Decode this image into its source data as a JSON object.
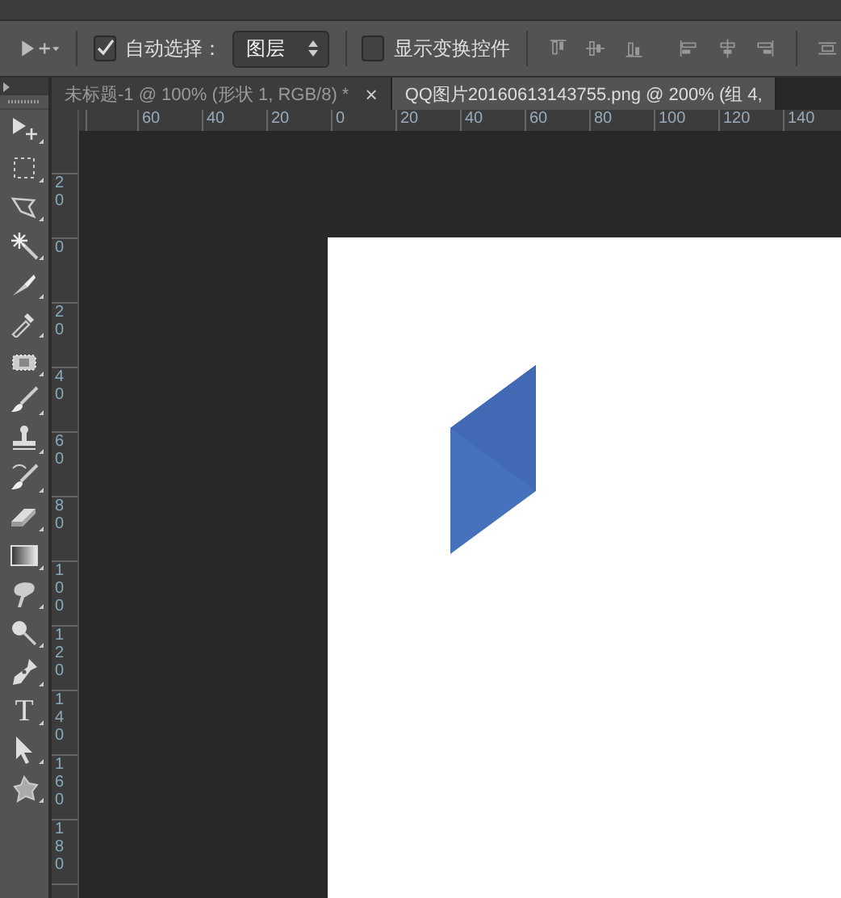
{
  "options_bar": {
    "auto_select": {
      "label": "自动选择：",
      "checked": true
    },
    "layer_select": {
      "value": "图层"
    },
    "show_transform": {
      "label": "显示变换控件",
      "checked": false
    }
  },
  "tabs": [
    {
      "label": "未标题-1 @ 100% (形状 1, RGB/8) *",
      "close": "×",
      "selected": false
    },
    {
      "label": "QQ图片20160613143755.png @ 200% (组 4,",
      "selected": true
    }
  ],
  "horizontal_ruler": [
    "60",
    "40",
    "20",
    "0",
    "20",
    "40",
    "60",
    "80",
    "100",
    "120",
    "140"
  ],
  "vertical_ruler": [
    "20",
    "0",
    "20",
    "40",
    "60",
    "80",
    "100",
    "120",
    "140",
    "160",
    "180"
  ],
  "tools": [
    {
      "kind": "move"
    },
    {
      "kind": "marquee"
    },
    {
      "kind": "lasso"
    },
    {
      "kind": "wand"
    },
    {
      "kind": "knife"
    },
    {
      "kind": "eyedropper"
    },
    {
      "kind": "bandage"
    },
    {
      "kind": "brush"
    },
    {
      "kind": "stamp"
    },
    {
      "kind": "history"
    },
    {
      "kind": "eraser"
    },
    {
      "kind": "gradient"
    },
    {
      "kind": "smudge"
    },
    {
      "kind": "dodge"
    },
    {
      "kind": "pen"
    },
    {
      "kind": "type",
      "glyph": "T"
    },
    {
      "kind": "select"
    },
    {
      "kind": "shape"
    }
  ]
}
